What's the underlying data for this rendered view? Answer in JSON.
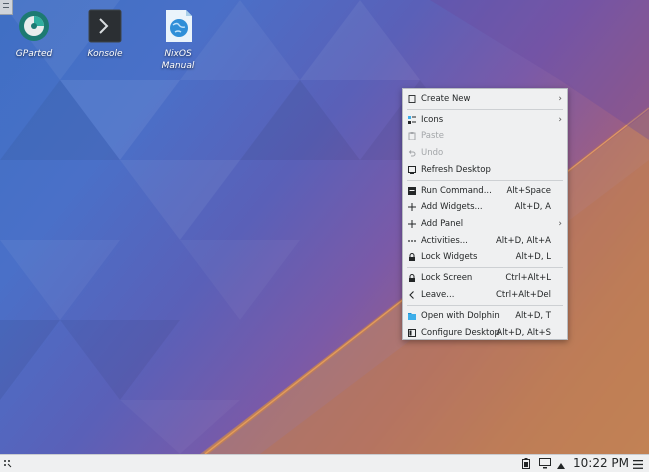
{
  "desktop": {
    "icons": [
      {
        "name": "GParted",
        "icon": "gparted-icon"
      },
      {
        "name": "Konsole",
        "icon": "terminal-icon"
      },
      {
        "name": "NixOS\nManual",
        "icon": "globe-icon"
      }
    ]
  },
  "context_menu": {
    "items": [
      {
        "label": "Create New",
        "shortcut": "",
        "submenu": true,
        "icon": "new-document-icon",
        "enabled": true
      },
      {
        "label": "Icons",
        "shortcut": "",
        "submenu": true,
        "icon": "icons-grid-icon",
        "enabled": true
      },
      {
        "label": "Paste",
        "shortcut": "",
        "submenu": false,
        "icon": "paste-icon",
        "enabled": false
      },
      {
        "label": "Undo",
        "shortcut": "",
        "submenu": false,
        "icon": "undo-icon",
        "enabled": false
      },
      {
        "label": "Refresh Desktop",
        "shortcut": "",
        "submenu": false,
        "icon": "refresh-desktop-icon",
        "enabled": true
      },
      {
        "label": "Run Command...",
        "shortcut": "Alt+Space",
        "submenu": false,
        "icon": "run-command-icon",
        "enabled": true
      },
      {
        "label": "Add Widgets...",
        "shortcut": "Alt+D, A",
        "submenu": false,
        "icon": "plus-icon",
        "enabled": true
      },
      {
        "label": "Add Panel",
        "shortcut": "",
        "submenu": true,
        "icon": "plus-icon",
        "enabled": true
      },
      {
        "label": "Activities...",
        "shortcut": "Alt+D, Alt+A",
        "submenu": false,
        "icon": "activities-icon",
        "enabled": true
      },
      {
        "label": "Lock Widgets",
        "shortcut": "Alt+D, L",
        "submenu": false,
        "icon": "lock-icon",
        "enabled": true
      },
      {
        "label": "Lock Screen",
        "shortcut": "Ctrl+Alt+L",
        "submenu": false,
        "icon": "lock-icon",
        "enabled": true
      },
      {
        "label": "Leave...",
        "shortcut": "Ctrl+Alt+Del",
        "submenu": false,
        "icon": "chevron-left-icon",
        "enabled": true
      },
      {
        "label": "Open with Dolphin",
        "shortcut": "Alt+D, T",
        "submenu": false,
        "icon": "folder-icon",
        "enabled": true
      },
      {
        "label": "Configure Desktop",
        "shortcut": "Alt+D, Alt+S",
        "submenu": false,
        "icon": "configure-desktop-icon",
        "enabled": true
      }
    ]
  },
  "taskbar": {
    "clock": "10:22 PM",
    "tray_icons": [
      "battery-icon",
      "display-icon",
      "tray-expand-arrow-icon",
      "hamburger-menu-icon"
    ],
    "launcher_icon": "application-launcher-icon"
  },
  "colors": {
    "menu_bg": "#eff0f1",
    "taskbar_bg": "#eff0f1",
    "disabled_text": "#a3a6a9",
    "folder_blue": "#3daee9"
  }
}
